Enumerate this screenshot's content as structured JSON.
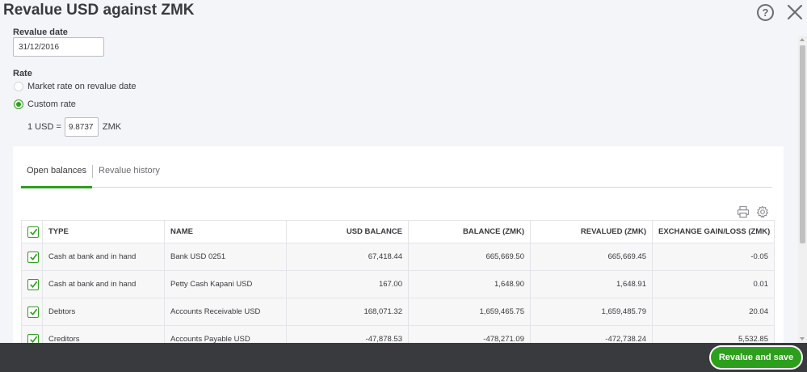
{
  "dialog": {
    "title": "Revalue USD against ZMK",
    "help_glyph": "?"
  },
  "revalue_date": {
    "label": "Revalue date",
    "value": "31/12/2016"
  },
  "rate": {
    "label": "Rate",
    "options": [
      {
        "label": "Market rate on revalue date",
        "checked": false
      },
      {
        "label": "Custom rate",
        "checked": true
      }
    ],
    "prefix": "1 USD =",
    "value": "9.8737",
    "suffix": "ZMK"
  },
  "tabs": [
    {
      "label": "Open balances",
      "active": true
    },
    {
      "label": "Revalue history",
      "active": false
    }
  ],
  "table": {
    "columns": [
      "TYPE",
      "NAME",
      "USD BALANCE",
      "BALANCE (ZMK)",
      "REVALUED (ZMK)",
      "EXCHANGE GAIN/LOSS (ZMK)"
    ],
    "rows": [
      {
        "type": "Cash at bank and in hand",
        "name": "Bank USD 0251",
        "usd_balance": "67,418.44",
        "balance_zmk": "665,669.50",
        "revalued_zmk": "665,669.45",
        "gain_loss": "-0.05"
      },
      {
        "type": "Cash at bank and in hand",
        "name": "Petty Cash Kapani USD",
        "usd_balance": "167.00",
        "balance_zmk": "1,648.90",
        "revalued_zmk": "1,648.91",
        "gain_loss": "0.01"
      },
      {
        "type": "Debtors",
        "name": "Accounts Receivable USD",
        "usd_balance": "168,071.32",
        "balance_zmk": "1,659,465.75",
        "revalued_zmk": "1,659,485.79",
        "gain_loss": "20.04"
      },
      {
        "type": "Creditors",
        "name": "Accounts Payable USD",
        "usd_balance": "-47,878.53",
        "balance_zmk": "-478,271.09",
        "revalued_zmk": "-472,738.24",
        "gain_loss": "5,532.85"
      }
    ]
  },
  "footer": {
    "save_label": "Revalue and save"
  },
  "colors": {
    "accent": "#2ca01c",
    "footer": "#393a3d"
  }
}
